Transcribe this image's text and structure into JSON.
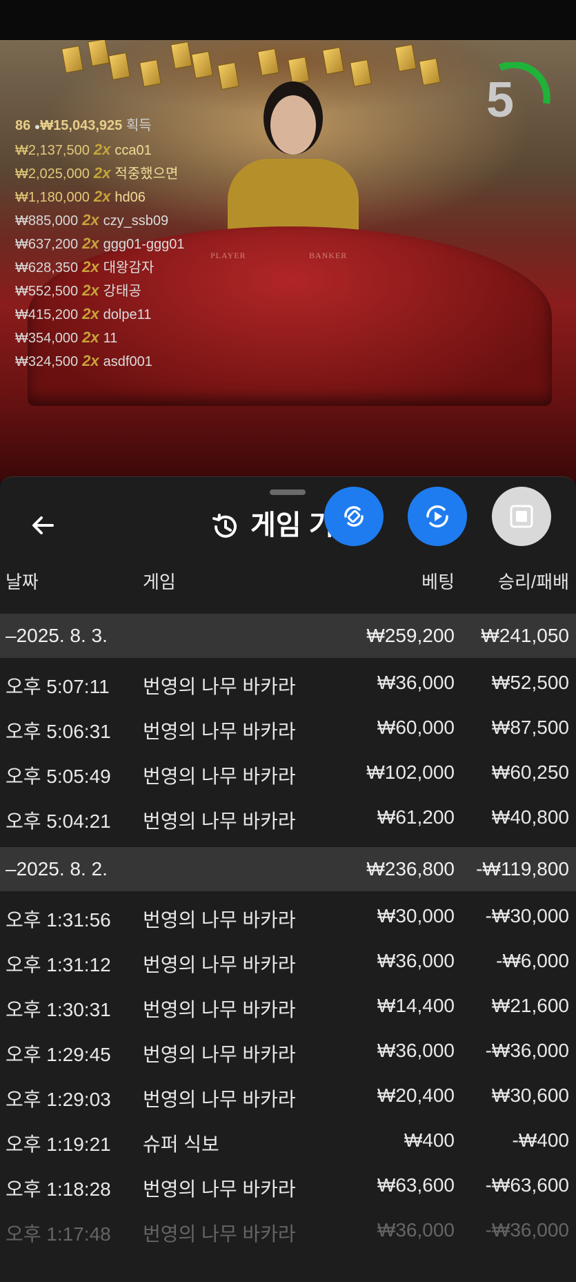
{
  "video": {
    "countdown": "5",
    "total": {
      "count": "86",
      "amount": "₩15,043,925",
      "label": "획득"
    },
    "winners": [
      {
        "amount": "₩2,137,500",
        "mult": "2x",
        "name": "cca01"
      },
      {
        "amount": "₩2,025,000",
        "mult": "2x",
        "name": "적중했으면"
      },
      {
        "amount": "₩1,180,000",
        "mult": "2x",
        "name": "hd06"
      },
      {
        "amount": "₩885,000",
        "mult": "2x",
        "name": "czy_ssb09"
      },
      {
        "amount": "₩637,200",
        "mult": "2x",
        "name": "ggg01-ggg01"
      },
      {
        "amount": "₩628,350",
        "mult": "2x",
        "name": "대왕감자"
      },
      {
        "amount": "₩552,500",
        "mult": "2x",
        "name": "강태공"
      },
      {
        "amount": "₩415,200",
        "mult": "2x",
        "name": "dolpe11"
      },
      {
        "amount": "₩354,000",
        "mult": "2x",
        "name": "11"
      },
      {
        "amount": "₩324,500",
        "mult": "2x",
        "name": "asdf001"
      }
    ],
    "table_labels": {
      "player": "PLAYER",
      "banker": "BANKER"
    }
  },
  "history": {
    "title": "게임 기",
    "columns": {
      "date": "날짜",
      "game": "게임",
      "bet": "베팅",
      "result": "승리/패배"
    },
    "groups": [
      {
        "date": "–2025. 8. 3.",
        "bet": "₩259,200",
        "result": "₩241,050",
        "rows": [
          {
            "time": "오후 5:07:11",
            "game": "번영의 나무 바카라",
            "bet": "₩36,000",
            "result": "₩52,500"
          },
          {
            "time": "오후 5:06:31",
            "game": "번영의 나무 바카라",
            "bet": "₩60,000",
            "result": "₩87,500"
          },
          {
            "time": "오후 5:05:49",
            "game": "번영의 나무 바카라",
            "bet": "₩102,000",
            "result": "₩60,250"
          },
          {
            "time": "오후 5:04:21",
            "game": "번영의 나무 바카라",
            "bet": "₩61,200",
            "result": "₩40,800"
          }
        ]
      },
      {
        "date": "–2025. 8. 2.",
        "bet": "₩236,800",
        "result": "-₩119,800",
        "rows": [
          {
            "time": "오후 1:31:56",
            "game": "번영의 나무 바카라",
            "bet": "₩30,000",
            "result": "-₩30,000"
          },
          {
            "time": "오후 1:31:12",
            "game": "번영의 나무 바카라",
            "bet": "₩36,000",
            "result": "-₩6,000"
          },
          {
            "time": "오후 1:30:31",
            "game": "번영의 나무 바카라",
            "bet": "₩14,400",
            "result": "₩21,600"
          },
          {
            "time": "오후 1:29:45",
            "game": "번영의 나무 바카라",
            "bet": "₩36,000",
            "result": "-₩36,000"
          },
          {
            "time": "오후 1:29:03",
            "game": "번영의 나무 바카라",
            "bet": "₩20,400",
            "result": "₩30,600"
          },
          {
            "time": "오후 1:19:21",
            "game": "슈퍼 식보",
            "bet": "₩400",
            "result": "-₩400"
          },
          {
            "time": "오후 1:18:28",
            "game": "번영의 나무 바카라",
            "bet": "₩63,600",
            "result": "-₩63,600"
          },
          {
            "time": "오후 1:17:48",
            "game": "번영의 나무 바카라",
            "bet": "₩36,000",
            "result": "-₩36,000"
          }
        ]
      }
    ]
  },
  "colors": {
    "accent_blue": "#1f7cf0",
    "gold": "#e2c97a",
    "sheet_bg": "#1d1d1d",
    "group_bg": "#363636"
  },
  "icons": {
    "back": "arrow-left-icon",
    "history": "history-clock-icon",
    "rotate": "screen-rotate-icon",
    "replay": "replay-icon",
    "stop": "stop-icon"
  }
}
